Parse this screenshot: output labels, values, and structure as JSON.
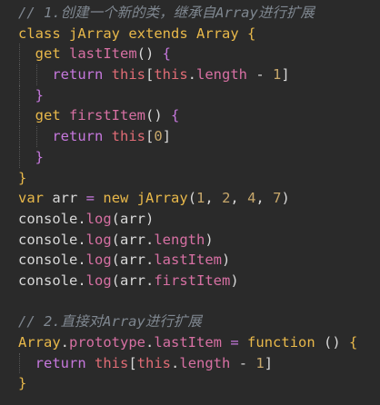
{
  "editor": {
    "lines": [
      {
        "tokens": [
          {
            "t": "// 1.创建一个新的类，继承自Array进行扩展",
            "c": "comment"
          }
        ],
        "indent": 0
      },
      {
        "tokens": [
          {
            "t": "class",
            "c": "kw"
          },
          {
            "t": " ",
            "c": "plain"
          },
          {
            "t": "jArray",
            "c": "cls"
          },
          {
            "t": " ",
            "c": "plain"
          },
          {
            "t": "extends",
            "c": "kw"
          },
          {
            "t": " ",
            "c": "plain"
          },
          {
            "t": "Array",
            "c": "cls"
          },
          {
            "t": " ",
            "c": "plain"
          },
          {
            "t": "{",
            "c": "brace"
          }
        ],
        "indent": 0
      },
      {
        "tokens": [
          {
            "t": "  ",
            "c": "plain"
          },
          {
            "t": "get",
            "c": "kw"
          },
          {
            "t": " ",
            "c": "plain"
          },
          {
            "t": "lastItem",
            "c": "prop"
          },
          {
            "t": "() ",
            "c": "plain"
          },
          {
            "t": "{",
            "c": "brace2"
          }
        ],
        "indent": 1
      },
      {
        "tokens": [
          {
            "t": "    ",
            "c": "plain"
          },
          {
            "t": "return",
            "c": "fn"
          },
          {
            "t": " ",
            "c": "plain"
          },
          {
            "t": "this",
            "c": "this"
          },
          {
            "t": "[",
            "c": "plain"
          },
          {
            "t": "this",
            "c": "this"
          },
          {
            "t": ".",
            "c": "plain"
          },
          {
            "t": "length",
            "c": "prop"
          },
          {
            "t": " - ",
            "c": "plain"
          },
          {
            "t": "1",
            "c": "num"
          },
          {
            "t": "]",
            "c": "plain"
          }
        ],
        "indent": 2
      },
      {
        "tokens": [
          {
            "t": "  ",
            "c": "plain"
          },
          {
            "t": "}",
            "c": "brace2"
          }
        ],
        "indent": 1
      },
      {
        "tokens": [
          {
            "t": "  ",
            "c": "plain"
          },
          {
            "t": "get",
            "c": "kw"
          },
          {
            "t": " ",
            "c": "plain"
          },
          {
            "t": "firstItem",
            "c": "prop"
          },
          {
            "t": "() ",
            "c": "plain"
          },
          {
            "t": "{",
            "c": "brace2"
          }
        ],
        "indent": 1
      },
      {
        "tokens": [
          {
            "t": "    ",
            "c": "plain"
          },
          {
            "t": "return",
            "c": "fn"
          },
          {
            "t": " ",
            "c": "plain"
          },
          {
            "t": "this",
            "c": "this"
          },
          {
            "t": "[",
            "c": "plain"
          },
          {
            "t": "0",
            "c": "num"
          },
          {
            "t": "]",
            "c": "plain"
          }
        ],
        "indent": 2
      },
      {
        "tokens": [
          {
            "t": "  ",
            "c": "plain"
          },
          {
            "t": "}",
            "c": "brace2"
          }
        ],
        "indent": 1
      },
      {
        "tokens": [
          {
            "t": "}",
            "c": "brace"
          }
        ],
        "indent": 0
      },
      {
        "tokens": [
          {
            "t": "var",
            "c": "kw"
          },
          {
            "t": " arr ",
            "c": "plain"
          },
          {
            "t": "=",
            "c": "op"
          },
          {
            "t": " ",
            "c": "plain"
          },
          {
            "t": "new",
            "c": "kw"
          },
          {
            "t": " ",
            "c": "plain"
          },
          {
            "t": "jArray",
            "c": "cls"
          },
          {
            "t": "(",
            "c": "plain"
          },
          {
            "t": "1",
            "c": "num"
          },
          {
            "t": ", ",
            "c": "plain"
          },
          {
            "t": "2",
            "c": "num"
          },
          {
            "t": ", ",
            "c": "plain"
          },
          {
            "t": "4",
            "c": "num"
          },
          {
            "t": ", ",
            "c": "plain"
          },
          {
            "t": "7",
            "c": "num"
          },
          {
            "t": ")",
            "c": "plain"
          }
        ],
        "indent": 0
      },
      {
        "tokens": [
          {
            "t": "console",
            "c": "plain"
          },
          {
            "t": ".",
            "c": "plain"
          },
          {
            "t": "log",
            "c": "prop"
          },
          {
            "t": "(arr)",
            "c": "plain"
          }
        ],
        "indent": 0
      },
      {
        "tokens": [
          {
            "t": "console",
            "c": "plain"
          },
          {
            "t": ".",
            "c": "plain"
          },
          {
            "t": "log",
            "c": "prop"
          },
          {
            "t": "(arr.",
            "c": "plain"
          },
          {
            "t": "length",
            "c": "prop"
          },
          {
            "t": ")",
            "c": "plain"
          }
        ],
        "indent": 0
      },
      {
        "tokens": [
          {
            "t": "console",
            "c": "plain"
          },
          {
            "t": ".",
            "c": "plain"
          },
          {
            "t": "log",
            "c": "prop"
          },
          {
            "t": "(arr.",
            "c": "plain"
          },
          {
            "t": "lastItem",
            "c": "prop"
          },
          {
            "t": ")",
            "c": "plain"
          }
        ],
        "indent": 0
      },
      {
        "tokens": [
          {
            "t": "console",
            "c": "plain"
          },
          {
            "t": ".",
            "c": "plain"
          },
          {
            "t": "log",
            "c": "prop"
          },
          {
            "t": "(arr.",
            "c": "plain"
          },
          {
            "t": "firstItem",
            "c": "prop"
          },
          {
            "t": ")",
            "c": "plain"
          }
        ],
        "indent": 0
      },
      {
        "tokens": [
          {
            "t": "",
            "c": "plain"
          }
        ],
        "indent": 0
      },
      {
        "tokens": [
          {
            "t": "// 2.直接对Array进行扩展",
            "c": "comment"
          }
        ],
        "indent": 0
      },
      {
        "tokens": [
          {
            "t": "Array",
            "c": "cls"
          },
          {
            "t": ".",
            "c": "plain"
          },
          {
            "t": "prototype",
            "c": "prop"
          },
          {
            "t": ".",
            "c": "plain"
          },
          {
            "t": "lastItem",
            "c": "prop"
          },
          {
            "t": " ",
            "c": "plain"
          },
          {
            "t": "=",
            "c": "op"
          },
          {
            "t": " ",
            "c": "plain"
          },
          {
            "t": "function",
            "c": "kw"
          },
          {
            "t": " () ",
            "c": "plain"
          },
          {
            "t": "{",
            "c": "brace"
          }
        ],
        "indent": 0
      },
      {
        "tokens": [
          {
            "t": "  ",
            "c": "plain"
          },
          {
            "t": "return",
            "c": "fn"
          },
          {
            "t": " ",
            "c": "plain"
          },
          {
            "t": "this",
            "c": "this"
          },
          {
            "t": "[",
            "c": "plain"
          },
          {
            "t": "this",
            "c": "this"
          },
          {
            "t": ".",
            "c": "plain"
          },
          {
            "t": "length",
            "c": "prop"
          },
          {
            "t": " - ",
            "c": "plain"
          },
          {
            "t": "1",
            "c": "num"
          },
          {
            "t": "]",
            "c": "plain"
          }
        ],
        "indent": 1
      },
      {
        "tokens": [
          {
            "t": "}",
            "c": "brace"
          }
        ],
        "indent": 0
      }
    ]
  }
}
